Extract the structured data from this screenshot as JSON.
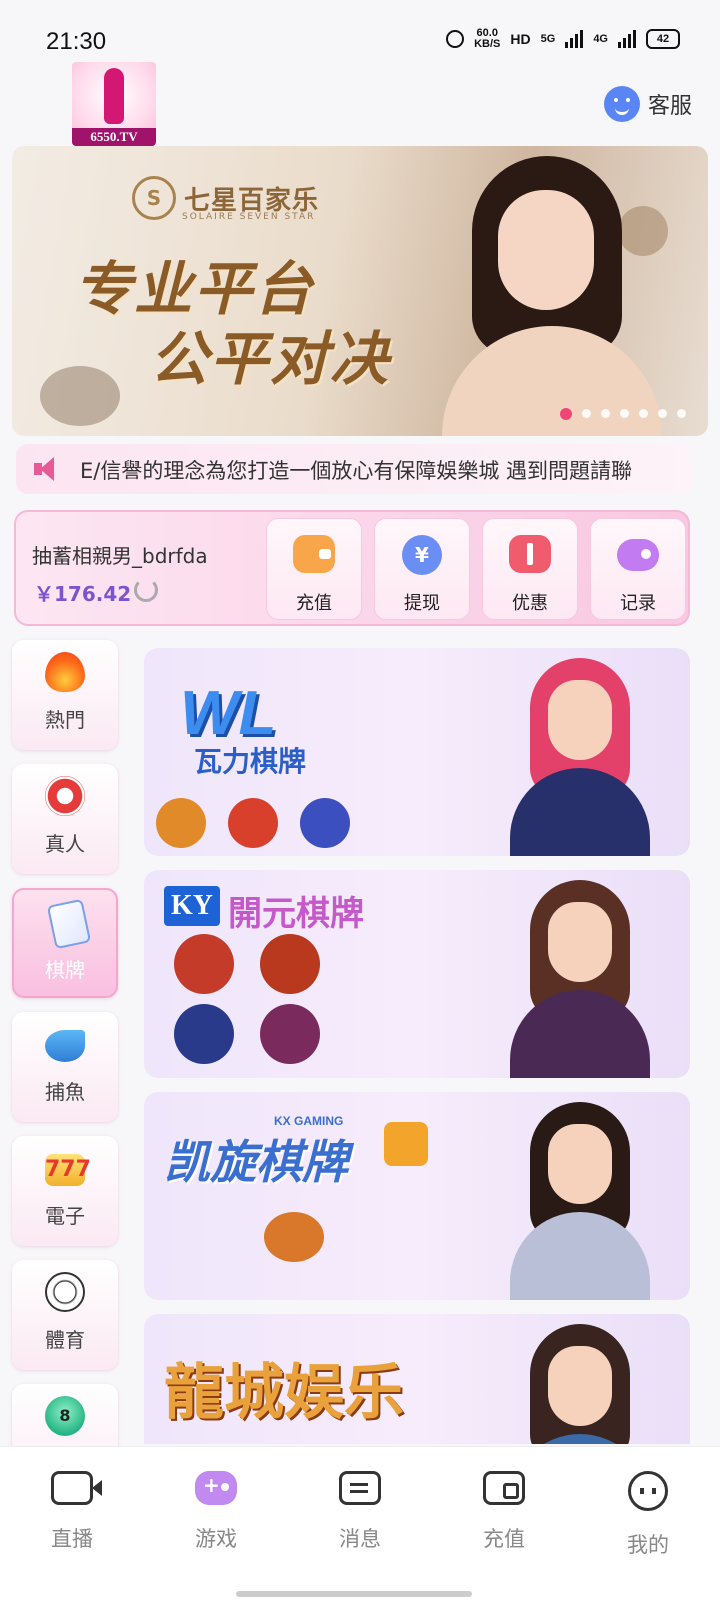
{
  "status_bar": {
    "time": "21:30",
    "net_speed": "60.0",
    "net_unit": "KB/S",
    "hd": "HD",
    "sig1": "5G",
    "sig2": "4G",
    "battery": "42"
  },
  "header": {
    "logo_text": "6550.TV",
    "service_label": "客服",
    "icons": {
      "service": "customer-service-icon",
      "alarm": "alarm-icon"
    }
  },
  "banner": {
    "brand_name": "七星百家乐",
    "brand_sub": "SOLAIRE SEVEN STAR",
    "headline_1": "专业平台",
    "headline_2": "公平对决",
    "slide_count": 7,
    "active_slide": 0
  },
  "notice": {
    "text": "E/信譽的理念為您打造一個放心有保障娛樂城  遇到問題請聯"
  },
  "user": {
    "name": "抽蓄相親男_bdrfda",
    "balance": "￥176.42"
  },
  "actions": [
    {
      "label": "充值",
      "icon": "wallet-icon"
    },
    {
      "label": "提现",
      "icon": "yen-icon"
    },
    {
      "label": "优惠",
      "icon": "ticket-icon"
    },
    {
      "label": "记录",
      "icon": "gamepad-icon"
    }
  ],
  "categories": [
    {
      "label": "熱門",
      "icon": "fire-icon"
    },
    {
      "label": "真人",
      "icon": "poker-chip-icon"
    },
    {
      "label": "棋牌",
      "icon": "cards-icon",
      "active": true
    },
    {
      "label": "捕魚",
      "icon": "shark-icon"
    },
    {
      "label": "電子",
      "icon": "slot-777-icon"
    },
    {
      "label": "體育",
      "icon": "soccer-ball-icon"
    },
    {
      "label": "",
      "icon": "lottery-ball-icon"
    }
  ],
  "games": [
    {
      "logo": "WL",
      "title": "瓦力棋牌"
    },
    {
      "logo": "KY",
      "title": "開元棋牌"
    },
    {
      "logo": "KX GAMING",
      "title": "凯旋棋牌"
    },
    {
      "logo": "",
      "title": "龍城娱乐"
    }
  ],
  "bottom_nav": [
    {
      "label": "直播",
      "icon": "video-camera-icon"
    },
    {
      "label": "游戏",
      "icon": "gamepad-icon",
      "active": true
    },
    {
      "label": "消息",
      "icon": "message-icon"
    },
    {
      "label": "充值",
      "icon": "wallet-icon"
    },
    {
      "label": "我的",
      "icon": "profile-face-icon"
    }
  ],
  "colors": {
    "accent": "#c08af0",
    "pink": "#f0356e",
    "balance": "#7a55cf"
  }
}
